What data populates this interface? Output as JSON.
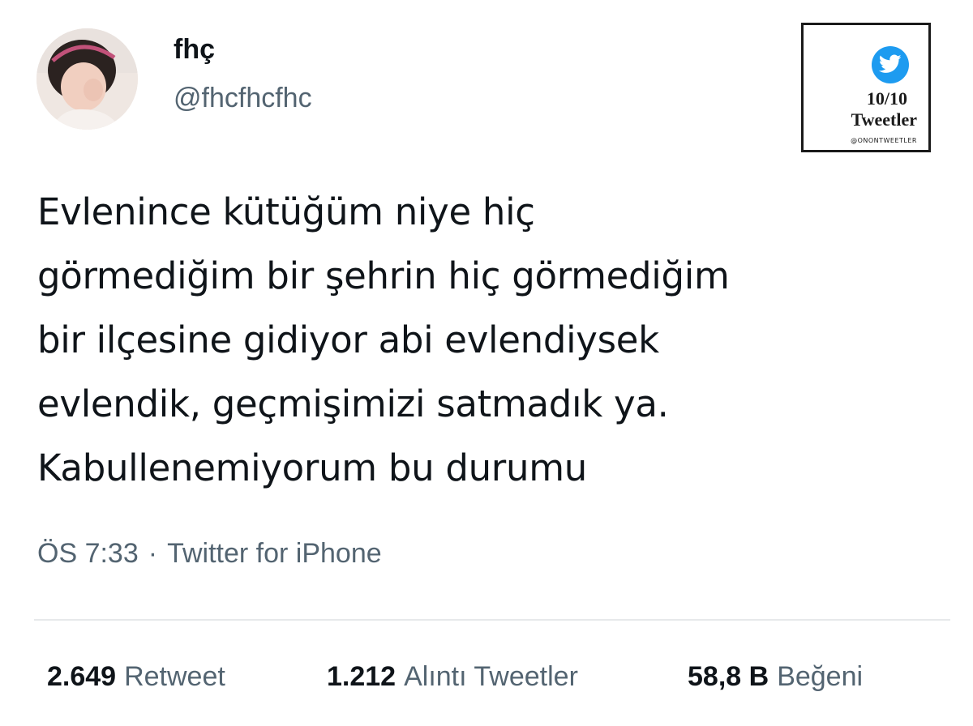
{
  "author": {
    "display_name": "fhç",
    "handle": "@fhcfhcfhc"
  },
  "badge": {
    "score": "10/10",
    "title": "Tweetler",
    "account": "@ONONTWEETLER",
    "icon": "twitter-bird-icon",
    "icon_color": "#1d9bf0"
  },
  "tweet": {
    "lines": [
      "Evlenince kütüğüm niye hiç",
      "görmediğim bir şehrin hiç görmediğim",
      "bir ilçesine gidiyor abi evlendiysek",
      "evlendik, geçmişimizi satmadık ya.",
      "Kabullenemiyorum bu durumu"
    ]
  },
  "meta": {
    "time": "ÖS 7:33",
    "separator": "·",
    "source": "Twitter for iPhone"
  },
  "stats": {
    "retweets": {
      "count": "2.649",
      "label": "Retweet"
    },
    "quotes": {
      "count": "1.212",
      "label": "Alıntı Tweetler"
    },
    "likes": {
      "count": "58,8 B",
      "label": "Beğeni"
    }
  },
  "colors": {
    "text_primary": "#0f1419",
    "text_secondary": "#536471",
    "divider": "#e7e9eb"
  }
}
